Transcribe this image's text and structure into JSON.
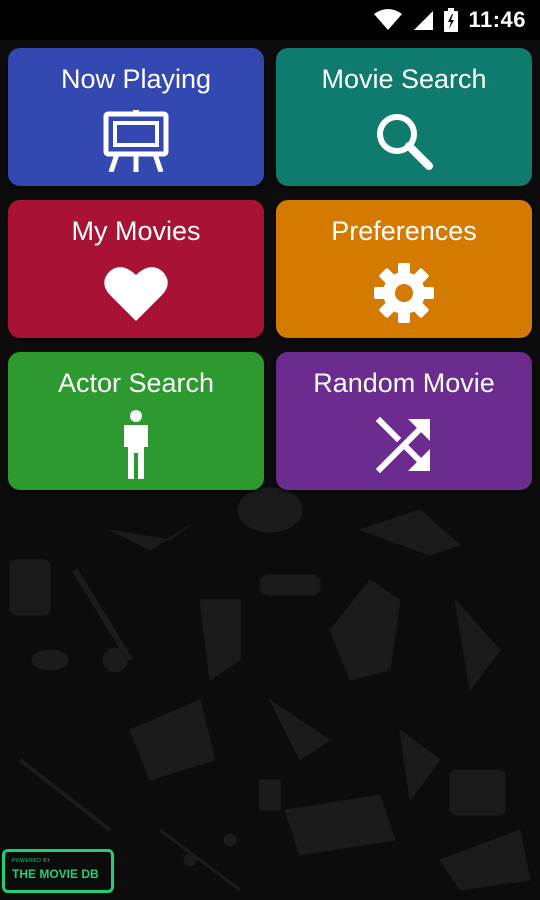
{
  "status": {
    "time": "11:46",
    "icons": [
      "wifi-icon",
      "cell-signal-icon",
      "battery-icon"
    ]
  },
  "tiles": [
    {
      "label": "Now Playing",
      "icon": "easel-screen-icon",
      "color": "#3349b1"
    },
    {
      "label": "Movie Search",
      "icon": "search-icon",
      "color": "#0f7a6e"
    },
    {
      "label": "My Movies",
      "icon": "heart-icon",
      "color": "#a81335"
    },
    {
      "label": "Preferences",
      "icon": "gear-icon",
      "color": "#d57a00"
    },
    {
      "label": "Actor Search",
      "icon": "person-icon",
      "color": "#2c9a2e"
    },
    {
      "label": "Random Movie",
      "icon": "shuffle-icon",
      "color": "#6b2b8f"
    }
  ],
  "footer": {
    "small_text": "POWERED BY",
    "brand_text": "THE MOVIE DB",
    "brand_color": "#1fcf7a"
  }
}
